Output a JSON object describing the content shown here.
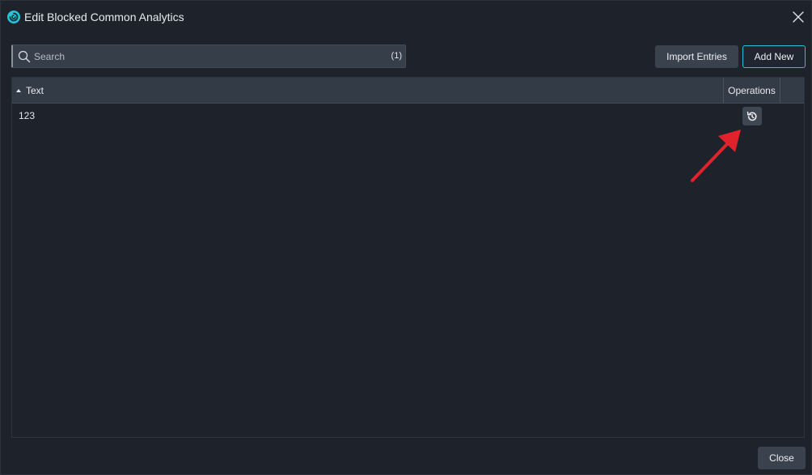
{
  "dialog": {
    "title": "Edit Blocked Common Analytics",
    "logo_icon": "app-logo-icon",
    "close_icon": "close-icon"
  },
  "toolbar": {
    "search": {
      "placeholder": "Search",
      "value": "",
      "count": "(1)",
      "icon": "search-icon"
    },
    "import_label": "Import Entries",
    "add_label": "Add New"
  },
  "table": {
    "columns": [
      {
        "label": "Text",
        "sort": "ascending"
      },
      {
        "label": "Operations"
      }
    ],
    "rows": [
      {
        "text": "123",
        "operation_icon": "restore-icon"
      }
    ]
  },
  "annotation": {
    "type": "arrow",
    "color": "#e0232b",
    "points_to": "restore-button"
  },
  "footer": {
    "close_label": "Close"
  },
  "colors": {
    "accent": "#27c2d8",
    "background": "#1d222b",
    "header": "#333b47",
    "button": "#3a424e"
  }
}
